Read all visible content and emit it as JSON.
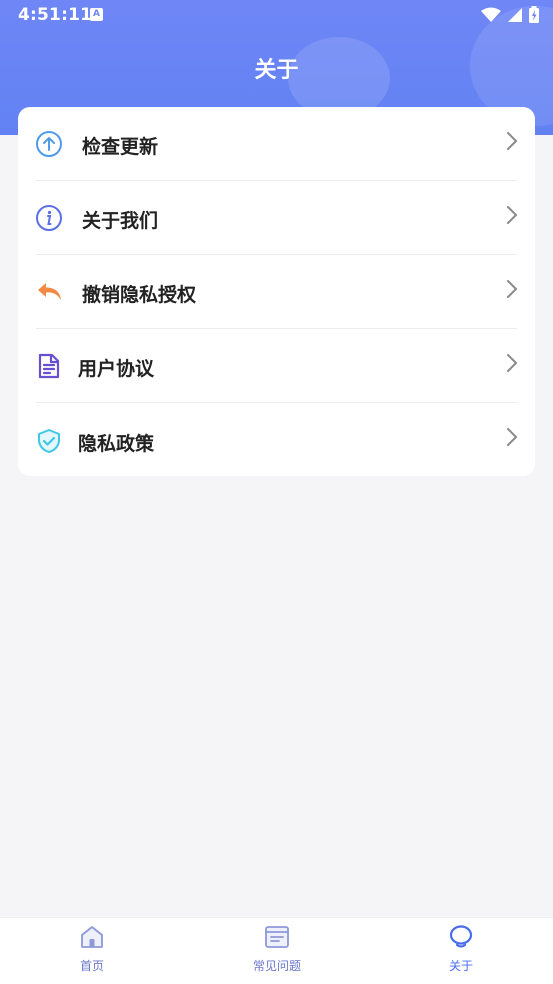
{
  "status_bar": {
    "time": "4:51:11",
    "badge": "A"
  },
  "header": {
    "title": "关于"
  },
  "menu": {
    "items": [
      {
        "label": "检查更新",
        "icon": "upload-arrow-icon"
      },
      {
        "label": "关于我们",
        "icon": "info-icon"
      },
      {
        "label": "撤销隐私授权",
        "icon": "reply-arrow-icon"
      },
      {
        "label": "用户协议",
        "icon": "document-icon"
      },
      {
        "label": "隐私政策",
        "icon": "shield-check-icon"
      }
    ]
  },
  "tabbar": {
    "tabs": [
      {
        "label": "首页",
        "icon": "home-icon"
      },
      {
        "label": "常见问题",
        "icon": "faq-icon"
      },
      {
        "label": "关于",
        "icon": "bulb-icon",
        "active": true
      }
    ]
  },
  "colors": {
    "header_start": "#6f86f6",
    "header_end": "#6282f3",
    "accent_blue": "#4a6cf0",
    "orange": "#f08a45",
    "purple": "#6a4fd1",
    "cyan": "#3fc7e6"
  }
}
